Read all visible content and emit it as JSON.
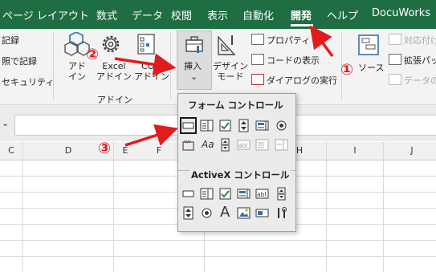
{
  "tabs": [
    {
      "label": "ページ レイアウト"
    },
    {
      "label": "数式"
    },
    {
      "label": "データ"
    },
    {
      "label": "校閲"
    },
    {
      "label": "表示"
    },
    {
      "label": "自動化"
    },
    {
      "label": "開発"
    },
    {
      "label": "ヘルプ"
    },
    {
      "label": "DocuWorks"
    }
  ],
  "ribbon": {
    "left_items": [
      "記録",
      "照で記録",
      "セキュリティ"
    ],
    "addins_group": {
      "label": "アドイン",
      "buttons": [
        {
          "label_l1": "アド",
          "label_l2": "イン"
        },
        {
          "label_l1": "Excel",
          "label_l2": "アドイン"
        },
        {
          "label_l1": "COM",
          "label_l2": "アドイン"
        }
      ]
    },
    "controls_group": {
      "insert": {
        "label": "挿入",
        "caret": "⌄"
      },
      "design_mode": {
        "label_l1": "デザイン",
        "label_l2": "モード"
      },
      "properties": "プロパティ",
      "view_code": "コードの表示",
      "run_dialog": "ダイアログの実行"
    },
    "xml_group": {
      "source": "ソース",
      "mapping": "対応付け",
      "expand_pack": "拡張パック",
      "refresh_data": "データの"
    }
  },
  "formula_bar": {
    "name_box_chevron": "⌄"
  },
  "column_headers": [
    "C",
    "D",
    "E",
    "F",
    "G",
    "H",
    "I",
    "J"
  ],
  "insert_dropdown": {
    "form_controls_title": "フォーム コントロール",
    "activex_title": "ActiveX コントロール",
    "form_controls": [
      "button",
      "combo-box",
      "check-box",
      "spin-button",
      "list-box",
      "option-button",
      "group-box",
      "label",
      "scroll-bar",
      "text-field",
      "combo-list-edit",
      "combo-drop-down-edit"
    ],
    "activex_controls": [
      "command-button",
      "combo-box",
      "check-box",
      "list-box",
      "text-box",
      "scroll-bar",
      "spin-button",
      "option-button",
      "label",
      "image",
      "toggle-button",
      "more-controls"
    ],
    "label_glyph": "Aa",
    "text_glyph": "abl",
    "big_a_glyph": "A"
  },
  "annotations": {
    "marker_1": "①",
    "marker_2": "②",
    "marker_3": "③",
    "color": "#e41a1c"
  }
}
